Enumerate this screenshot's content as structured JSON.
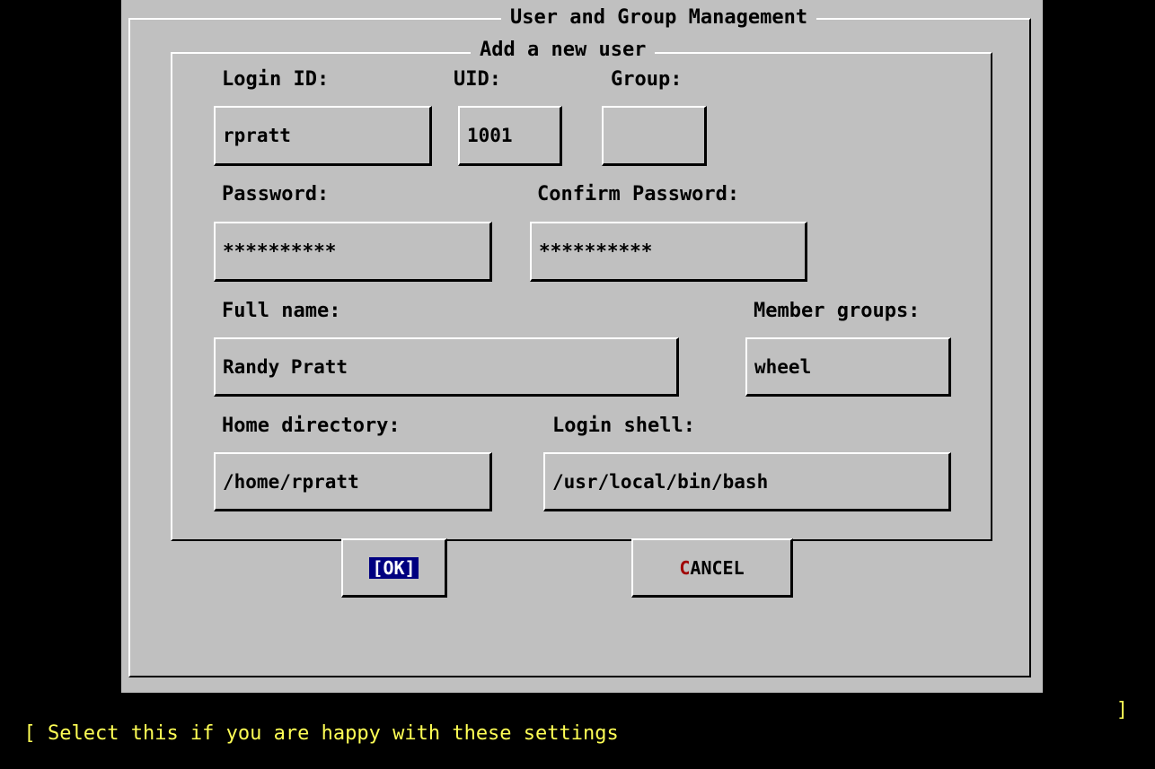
{
  "dialog": {
    "title": "User and Group Management",
    "subtitle": "Add a new user"
  },
  "labels": {
    "login_id": "Login ID:",
    "uid": "UID:",
    "group": "Group:",
    "password": "Password:",
    "confirm_password": "Confirm Password:",
    "full_name": "Full name:",
    "member_groups": "Member groups:",
    "home_directory": "Home directory:",
    "login_shell": "Login shell:"
  },
  "fields": {
    "login_id": "rpratt",
    "uid": "1001",
    "group": "",
    "password": "**********",
    "confirm_password": "**********",
    "full_name": "Randy Pratt",
    "member_groups": "wheel",
    "home_directory": "/home/rpratt",
    "login_shell": "/usr/local/bin/bash"
  },
  "buttons": {
    "ok": "[OK]",
    "cancel_hotkey": "C",
    "cancel_rest": "ANCEL"
  },
  "status_bar": {
    "left": "[ Select this if you are happy with these settings",
    "right": "]"
  },
  "colors": {
    "panel": "#c0c0c0",
    "focus": "#000080",
    "status_text": "#ffff55",
    "hotkey": "#a00000"
  }
}
